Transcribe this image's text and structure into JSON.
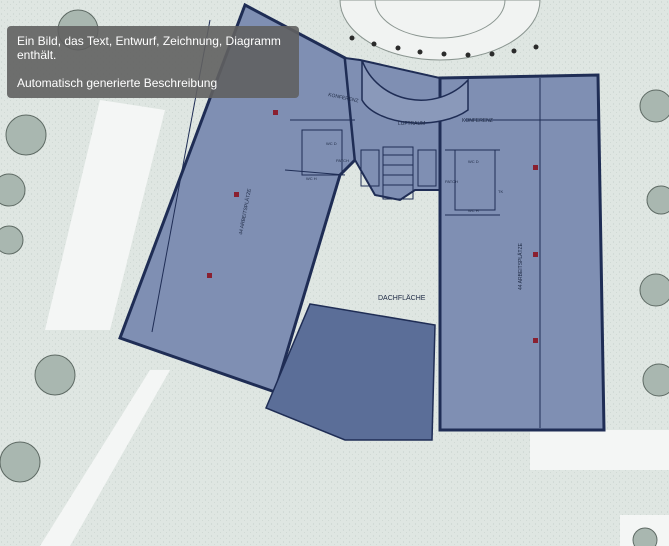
{
  "tooltip": {
    "caption": "Ein Bild, das Text, Entwurf, Zeichnung, Diagramm enthält.",
    "subtitle": "Automatisch generierte Beschreibung"
  },
  "plan_labels": {
    "konferenz_left": "KONFERENZ",
    "luftraum": "LUFTRAUM",
    "konferenz_right": "KONFERENZ",
    "arbeitsplaetze_left": "44 ARBEITSPLÄTZE",
    "arbeitsplaetze_right": "44 ARBEITSPLÄTZE",
    "dachflaeche": "DACHFLÄCHE",
    "patch_left": "PATCH",
    "patch_right": "PATCH",
    "wc_d_left": "WC D",
    "wc_h_left": "WC H",
    "wc_d_right": "WC D",
    "wc_h_right": "WC H",
    "tk": "TK"
  },
  "colors": {
    "office_fill": "#7f8fb3",
    "roof_fill": "#5b6e98",
    "ground": "#dfe6e2",
    "tree": "#a9b7b0"
  }
}
